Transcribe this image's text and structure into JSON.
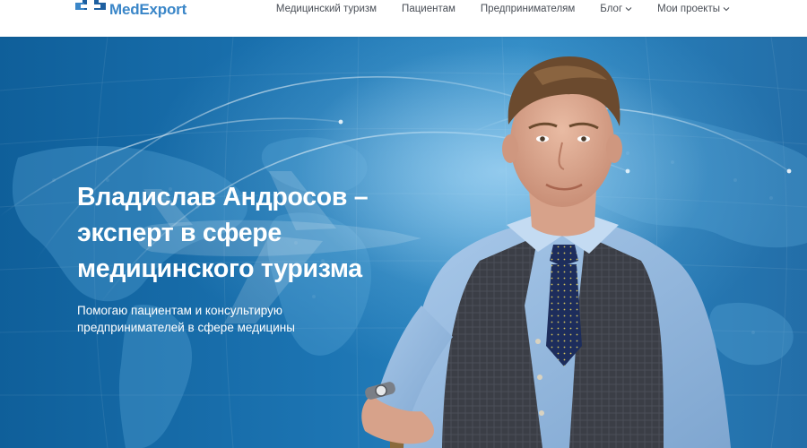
{
  "brand": {
    "name": "MedExport",
    "color": "#3a86c8"
  },
  "nav": {
    "items": [
      {
        "label": "Медицинский туризм",
        "has_dropdown": false
      },
      {
        "label": "Пациентам",
        "has_dropdown": false
      },
      {
        "label": "Предпринимателям",
        "has_dropdown": false
      },
      {
        "label": "Блог",
        "has_dropdown": true
      },
      {
        "label": "Мои проекты",
        "has_dropdown": true
      }
    ]
  },
  "hero": {
    "title_lines": [
      "Владислав Андросов –",
      "эксперт в сфере",
      "медицинского туризма"
    ],
    "subtitle_lines": [
      "Помогаю пациентам и консультирую",
      "предпринимателей в сфере медицины"
    ],
    "background_color": "#1c74b2"
  }
}
